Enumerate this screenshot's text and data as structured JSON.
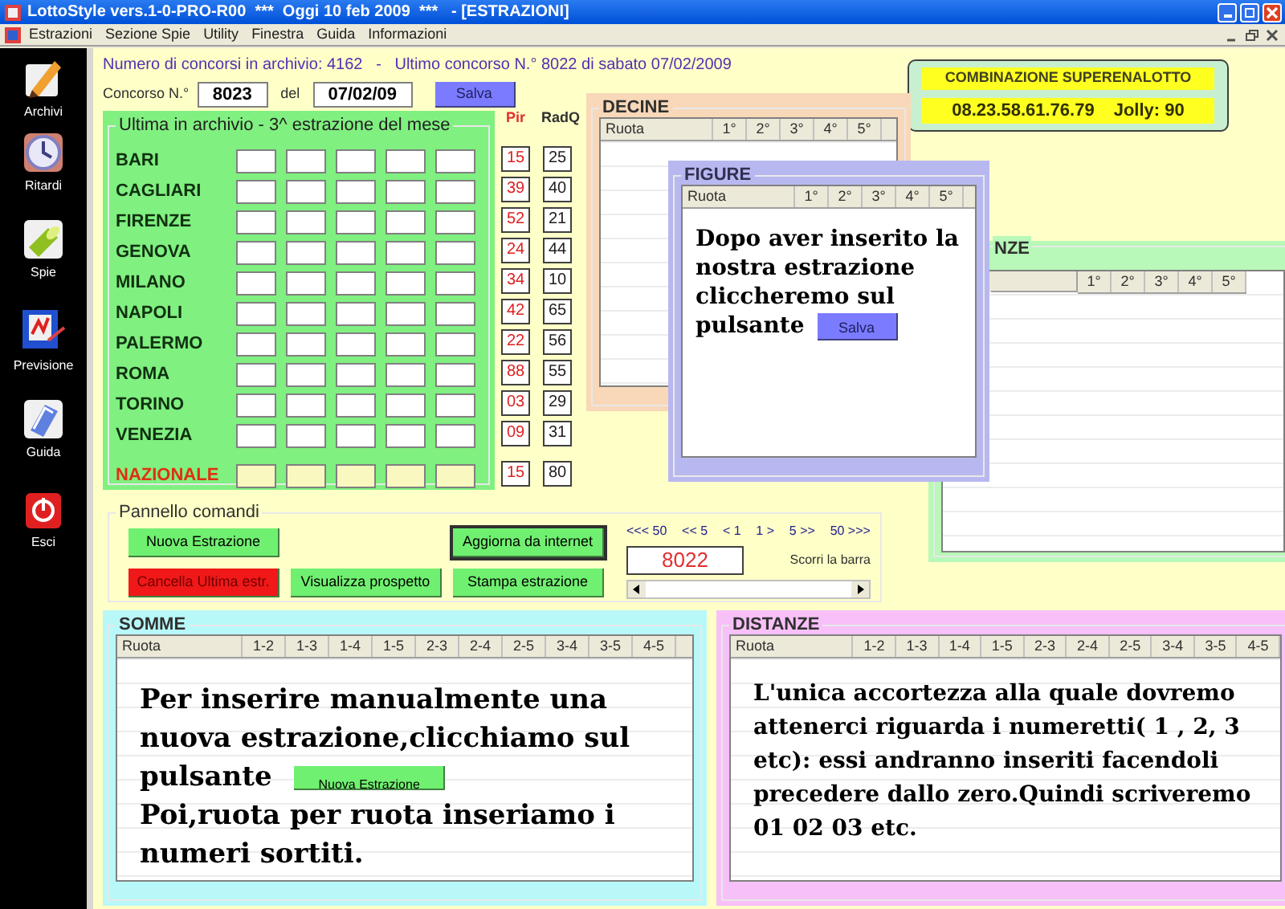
{
  "window": {
    "title": "LottoStyle vers.1-0-PRO-R00  ***  Oggi 10 feb 2009  ***   - [ESTRAZIONI]"
  },
  "menu": [
    "Estrazioni",
    "Sezione Spie",
    "Utility",
    "Finestra",
    "Guida",
    "Informazioni"
  ],
  "sidebar": [
    {
      "label": "Archivi",
      "kind": "archive"
    },
    {
      "label": "Ritardi",
      "kind": "delays"
    },
    {
      "label": "Spie",
      "kind": "spies"
    },
    {
      "label": "Previsione",
      "kind": "forecast"
    },
    {
      "label": "Guida",
      "kind": "guide"
    },
    {
      "label": "Esci",
      "kind": "exit"
    }
  ],
  "archive_info": "Numero di concorsi in archivio: 4162   -   Ultimo concorso N.° 8022 di sabato 07/02/2009",
  "concorso": {
    "label": "Concorso N.°",
    "number": "8023",
    "date_label": "del",
    "date": "07/02/09",
    "save_button": "Salva"
  },
  "estrazione": {
    "title": "Ultima in archivio - 3^ estrazione del mese",
    "pir_header": "Pir",
    "radq_header": "RadQ",
    "rows": [
      {
        "ruota": "BARI",
        "pir": "15",
        "radq": "25",
        "kind": "regular"
      },
      {
        "ruota": "CAGLIARI",
        "pir": "39",
        "radq": "40",
        "kind": "regular"
      },
      {
        "ruota": "FIRENZE",
        "pir": "52",
        "radq": "21",
        "kind": "regular"
      },
      {
        "ruota": "GENOVA",
        "pir": "24",
        "radq": "44",
        "kind": "regular"
      },
      {
        "ruota": "MILANO",
        "pir": "34",
        "radq": "10",
        "kind": "regular"
      },
      {
        "ruota": "NAPOLI",
        "pir": "42",
        "radq": "65",
        "kind": "regular"
      },
      {
        "ruota": "PALERMO",
        "pir": "22",
        "radq": "56",
        "kind": "regular"
      },
      {
        "ruota": "ROMA",
        "pir": "88",
        "radq": "55",
        "kind": "regular"
      },
      {
        "ruota": "TORINO",
        "pir": "03",
        "radq": "29",
        "kind": "regular"
      },
      {
        "ruota": "VENEZIA",
        "pir": "09",
        "radq": "31",
        "kind": "regular"
      },
      {
        "ruota": "NAZIONALE",
        "pir": "15",
        "radq": "80",
        "kind": "national"
      }
    ]
  },
  "combination": {
    "title": "COMBINAZIONE SUPERENALOTTO",
    "numbers": "08.23.58.61.76.79",
    "jolly": "Jolly: 90"
  },
  "decine": {
    "title": "DECINE",
    "columns": [
      "Ruota",
      "1°",
      "2°",
      "3°",
      "4°",
      "5°"
    ]
  },
  "frequenze": {
    "title": "NZE",
    "columns": [
      "1°",
      "2°",
      "3°",
      "4°",
      "5°"
    ]
  },
  "figure": {
    "title": "FIGURE",
    "columns": [
      "Ruota",
      "1°",
      "2°",
      "3°",
      "4°",
      "5°"
    ],
    "note": "Dopo aver inserito la nostra estrazione cliccheremo sul",
    "note_end": "pulsante",
    "note_button": "Salva"
  },
  "commands": {
    "title": "Pannello comandi",
    "button_rows": [
      [
        {
          "label": "Nuova Estrazione",
          "kind": "normal",
          "focused": false
        },
        {
          "label": "Aggiorna da internet",
          "kind": "normal",
          "focused": true
        }
      ],
      [
        {
          "label": "Cancella Ultima estr.",
          "kind": "danger",
          "focused": false
        },
        {
          "label": "Visualizza prospetto",
          "kind": "normal",
          "focused": false
        },
        {
          "label": "Stampa estrazione",
          "kind": "normal",
          "focused": false
        }
      ]
    ],
    "nav_links": [
      "<<< 50",
      "<< 5",
      "< 1",
      "1 >",
      "5 >>",
      "50 >>>"
    ],
    "counter": "8022",
    "scroll_label": "Scorri la barra"
  },
  "somme": {
    "title": "SOMME",
    "columns": [
      "Ruota",
      "1-2",
      "1-3",
      "1-4",
      "1-5",
      "2-3",
      "2-4",
      "2-5",
      "3-4",
      "3-5",
      "4-5"
    ],
    "note": "Per inserire manualmente una nuova estrazione,clicchiamo sul",
    "note_end": "pulsante",
    "note_button": "Nuova Estrazione",
    "note_after": "Poi,ruota per ruota inseriamo i numeri sortiti."
  },
  "distanze": {
    "title": "DISTANZE",
    "columns": [
      "Ruota",
      "1-2",
      "1-3",
      "1-4",
      "1-5",
      "2-3",
      "2-4",
      "2-5",
      "3-4",
      "3-5",
      "4-5"
    ],
    "note": "L'unica accortezza alla quale dovremo attenerci riguarda i numeretti( 1 , 2, 3 etc): essi andranno inseriti facendoli precedere dallo zero.Quindi scriveremo 01 02 03 etc."
  }
}
